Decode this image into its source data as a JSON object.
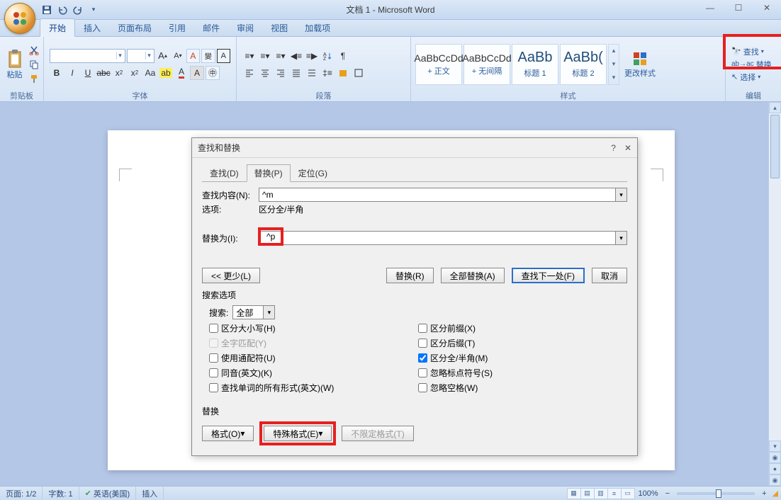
{
  "title": "文档 1 - Microsoft Word",
  "window_controls": {
    "min": "—",
    "max": "☐",
    "close": "✕"
  },
  "tabs": [
    "开始",
    "插入",
    "页面布局",
    "引用",
    "邮件",
    "审阅",
    "视图",
    "加载项"
  ],
  "active_tab": 0,
  "groups": {
    "clipboard": {
      "label": "剪贴板",
      "paste": "粘贴"
    },
    "font": {
      "label": "字体"
    },
    "paragraph": {
      "label": "段落"
    },
    "styles": {
      "label": "样式",
      "items": [
        {
          "preview": "AaBbCcDd",
          "name": "+ 正文"
        },
        {
          "preview": "AaBbCcDd",
          "name": "+ 无间隔"
        },
        {
          "preview": "AaBb",
          "name": "标题 1"
        },
        {
          "preview": "AaBb(",
          "name": "标题 2"
        }
      ],
      "change": "更改样式"
    },
    "editing": {
      "label": "编辑",
      "find": "查找",
      "replace": "替换",
      "select": "选择"
    }
  },
  "dialog": {
    "title": "查找和替换",
    "help": "?",
    "close": "✕",
    "tabs": {
      "find": "查找(D)",
      "replace": "替换(P)",
      "goto": "定位(G)"
    },
    "active_tab": "replace",
    "find_label": "查找内容(N):",
    "find_value": "^m",
    "options_label": "选项:",
    "options_value": "区分全/半角",
    "replace_label": "替换为(I):",
    "replace_value": "^p",
    "buttons": {
      "less": "<< 更少(L)",
      "replace": "替换(R)",
      "replace_all": "全部替换(A)",
      "find_next": "查找下一处(F)",
      "cancel": "取消"
    },
    "search_options_label": "搜索选项",
    "search_dir_label": "搜索:",
    "search_dir_value": "全部",
    "checkboxes_left": [
      {
        "label": "区分大小写(H)",
        "checked": false,
        "disabled": false
      },
      {
        "label": "全字匹配(Y)",
        "checked": false,
        "disabled": true
      },
      {
        "label": "使用通配符(U)",
        "checked": false,
        "disabled": false
      },
      {
        "label": "同音(英文)(K)",
        "checked": false,
        "disabled": false
      },
      {
        "label": "查找单词的所有形式(英文)(W)",
        "checked": false,
        "disabled": false
      }
    ],
    "checkboxes_right": [
      {
        "label": "区分前缀(X)",
        "checked": false
      },
      {
        "label": "区分后缀(T)",
        "checked": false
      },
      {
        "label": "区分全/半角(M)",
        "checked": true
      },
      {
        "label": "忽略标点符号(S)",
        "checked": false
      },
      {
        "label": "忽略空格(W)",
        "checked": false
      }
    ],
    "replace_section": "替换",
    "format_btn": "格式(O)",
    "special_btn": "特殊格式(E)",
    "noformat_btn": "不限定格式(T)"
  },
  "status": {
    "page": "页面: 1/2",
    "words": "字数: 1",
    "lang": "英语(美国)",
    "mode": "插入",
    "zoom": "100%"
  }
}
